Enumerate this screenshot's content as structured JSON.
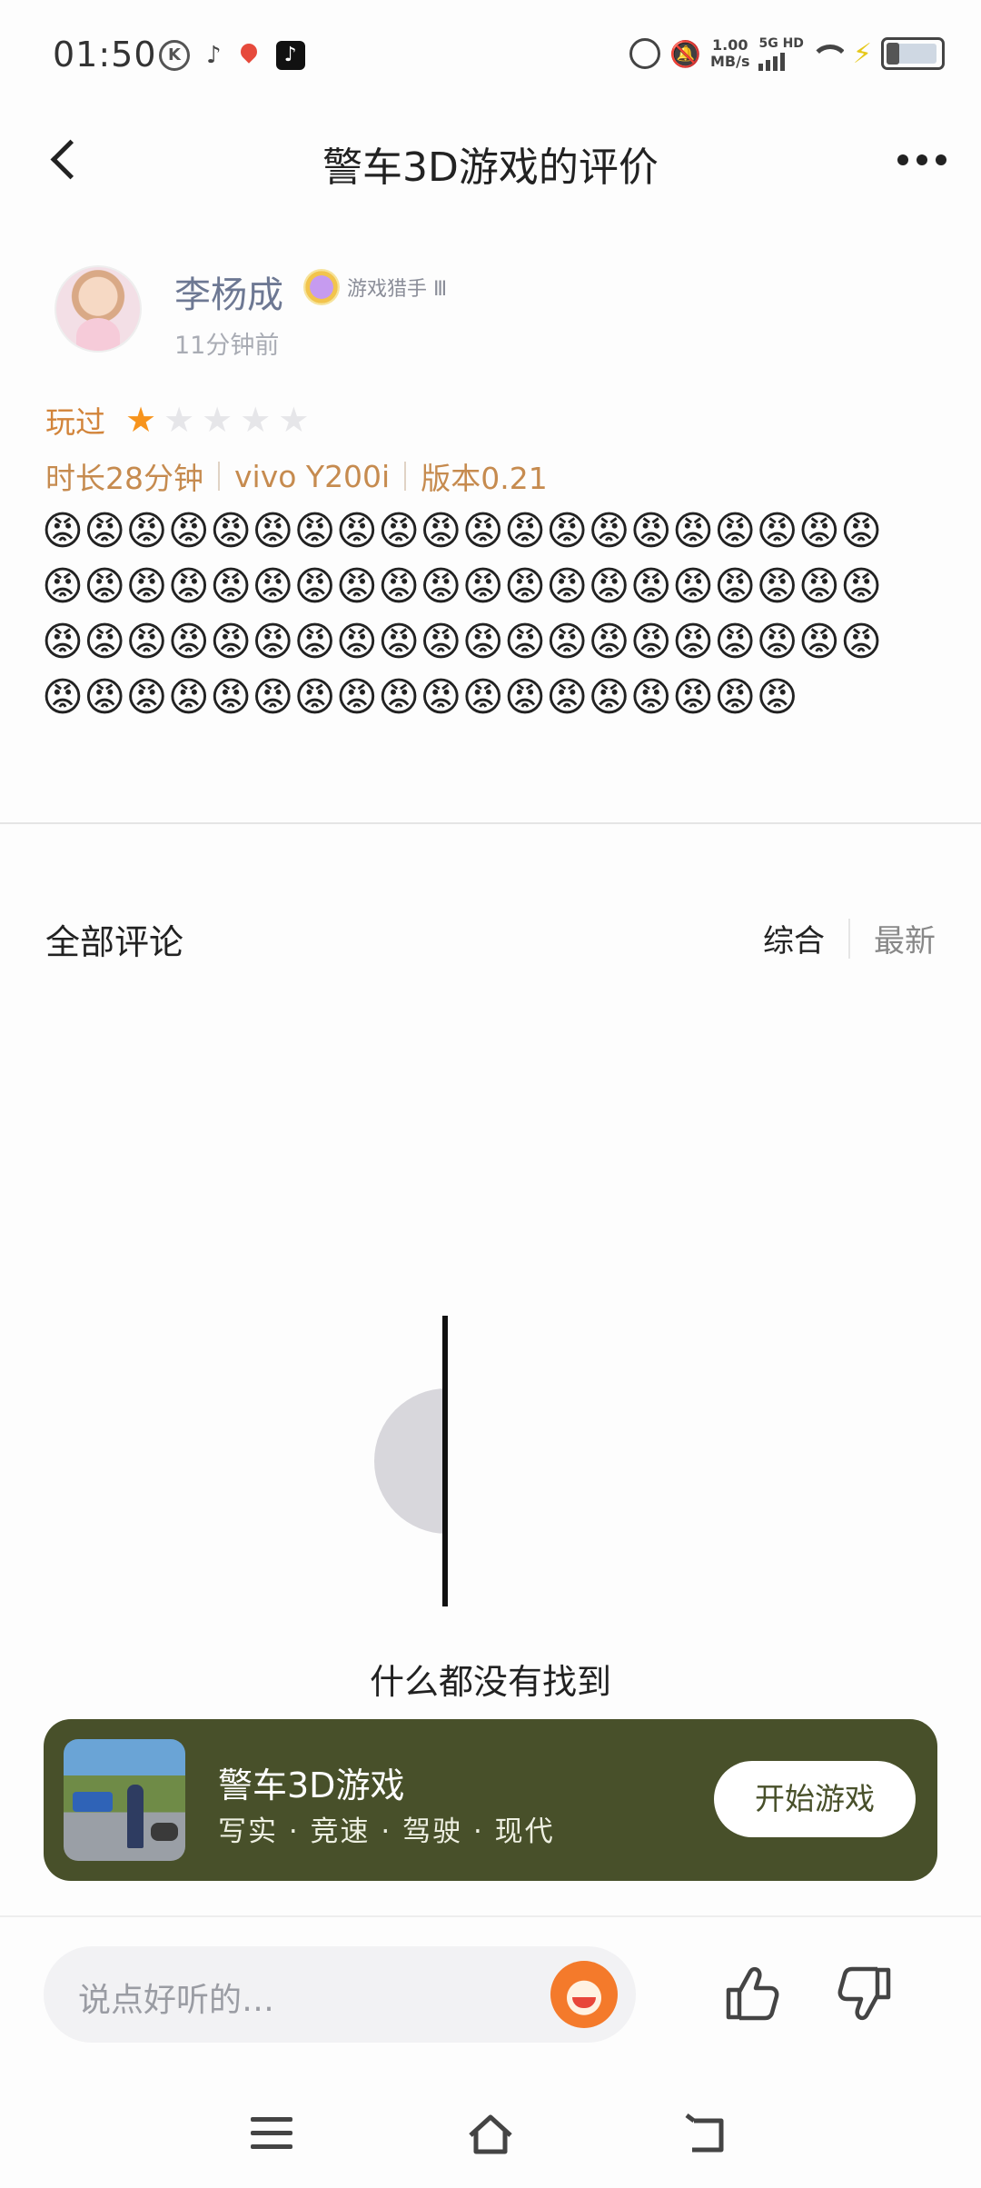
{
  "status_bar": {
    "time": "01:50",
    "speed_value": "1.00",
    "speed_unit": "MB/s",
    "network": "5G HD"
  },
  "header": {
    "title": "警车3D游戏的评价"
  },
  "review": {
    "username": "李杨成",
    "badge": "游戏猎手 Ⅲ",
    "time": "11分钟前",
    "played_label": "玩过",
    "rating": 1,
    "rating_max": 5,
    "duration": "时长28分钟",
    "device": "vivo Y200i",
    "version": "版本0.21",
    "content": "😡😡😡😡😡😡😡😡😡😡😡😡😡😡😡😡😡😡😡😡😡😡😡😡😡😡😡😡😡😡😡😡😡😡😡😡😡😡😡😡😡😡😡😡😡😡😡😡😡😡😡😡😡😡😡😡😡😡😡😡😡😡😡😡😡😡😡😡😡😡😡😡😡😡😡😡😡😡"
  },
  "comments": {
    "title": "全部评论",
    "sort_active": "综合",
    "sort_other": "最新",
    "empty_text": "什么都没有找到"
  },
  "game_card": {
    "name": "警车3D游戏",
    "tags": "写实 · 竞速 · 驾驶 · 现代",
    "start_label": "开始游戏"
  },
  "bottom_bar": {
    "placeholder": "说点好听的…"
  },
  "colors": {
    "accent_orange": "#f7941d",
    "meta_text": "#c68b4f",
    "card_bg": "#48502a"
  }
}
